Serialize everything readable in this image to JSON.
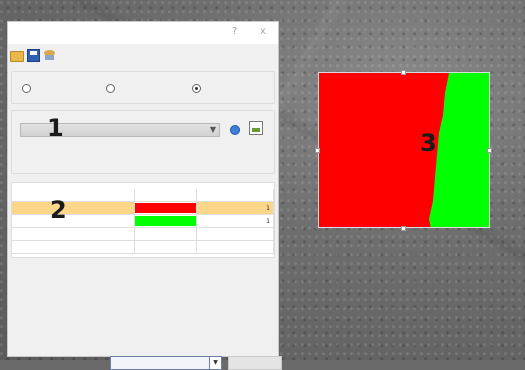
{
  "dialog": {
    "help_label": "?",
    "close_label": "x",
    "toolbar_icons": [
      "folder-open-icon",
      "save-icon",
      "database-icon"
    ],
    "radio_group": {
      "options": [
        "",
        "",
        ""
      ],
      "selected_index": 2
    },
    "combo": {
      "value": ""
    },
    "table": {
      "rows": [
        {
          "selected": false,
          "swatch": "",
          "value": ""
        },
        {
          "selected": true,
          "swatch": "#ff0000",
          "value": "1"
        },
        {
          "selected": false,
          "swatch": "#00ff00",
          "value": "1"
        },
        {
          "selected": false,
          "swatch": "",
          "value": ""
        },
        {
          "selected": false,
          "swatch": "",
          "value": ""
        }
      ]
    },
    "status": {
      "combo_value": "",
      "button_label": ""
    }
  },
  "annotations": {
    "one": "1",
    "two": "2",
    "three": "3"
  },
  "result_image": {
    "region_colors": [
      "#ff0000",
      "#00ff00"
    ]
  }
}
